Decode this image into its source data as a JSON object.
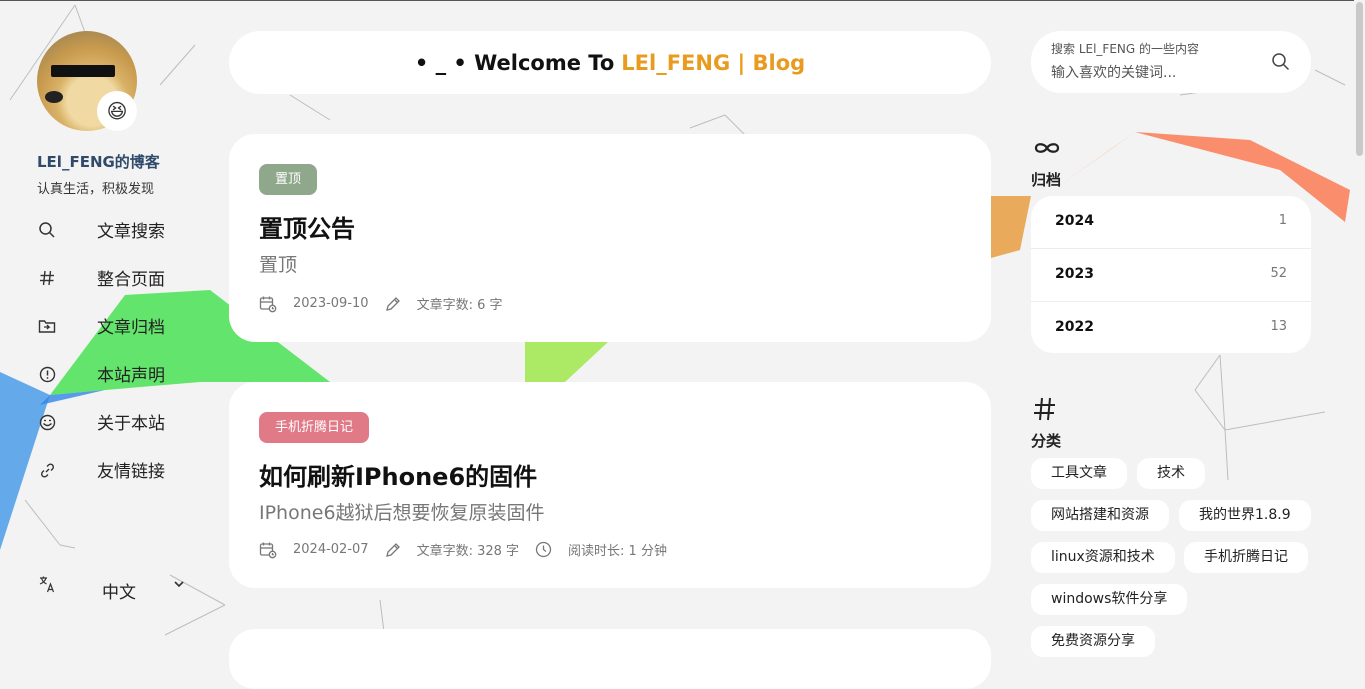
{
  "sidebar": {
    "site_name": "LEl_FENG的博客",
    "site_desc": "认真生活，积极发现",
    "avatar_badge": "😆",
    "nav": [
      {
        "label": "文章搜索",
        "icon": "search-icon"
      },
      {
        "label": "整合页面",
        "icon": "hash-icon"
      },
      {
        "label": "文章归档",
        "icon": "archive-icon"
      },
      {
        "label": "本站声明",
        "icon": "info-icon"
      },
      {
        "label": "关于本站",
        "icon": "smile-icon"
      },
      {
        "label": "友情链接",
        "icon": "link-icon"
      }
    ],
    "language": {
      "label": "中文",
      "icon": "translate-icon"
    }
  },
  "header": {
    "prefix": "• _ •  Welcome To",
    "accent": "LEl_FENG | Blog",
    "accent_color": "#e89b1f"
  },
  "posts": [
    {
      "tag": "置顶",
      "tag_color": "#8fa88c",
      "title": "置顶公告",
      "subtitle": "置顶",
      "date": "2023-09-10",
      "words": "文章字数: 6 字"
    },
    {
      "tag": "手机折腾日记",
      "tag_color": "#e07a87",
      "title": "如何刷新IPhone6的固件",
      "subtitle": "IPhone6越狱后想要恢复原装固件",
      "date": "2024-02-07",
      "words": "文章字数: 328 字",
      "read_time": "阅读时长: 1 分钟"
    }
  ],
  "search": {
    "hint": "搜索 LEl_FENG 的一些内容",
    "placeholder": "输入喜欢的关键词..."
  },
  "archive": {
    "icon": "infinity-icon",
    "label": "归档",
    "rows": [
      {
        "year": "2024",
        "count": "1"
      },
      {
        "year": "2023",
        "count": "52"
      },
      {
        "year": "2022",
        "count": "13"
      }
    ]
  },
  "categories": {
    "icon": "hash-icon",
    "label": "分类",
    "items": [
      "工具文章",
      "技术",
      "网站搭建和资源",
      "我的世界1.8.9",
      "linux资源和技术",
      "手机折腾日记",
      "windows软件分享",
      "免费资源分享"
    ]
  }
}
